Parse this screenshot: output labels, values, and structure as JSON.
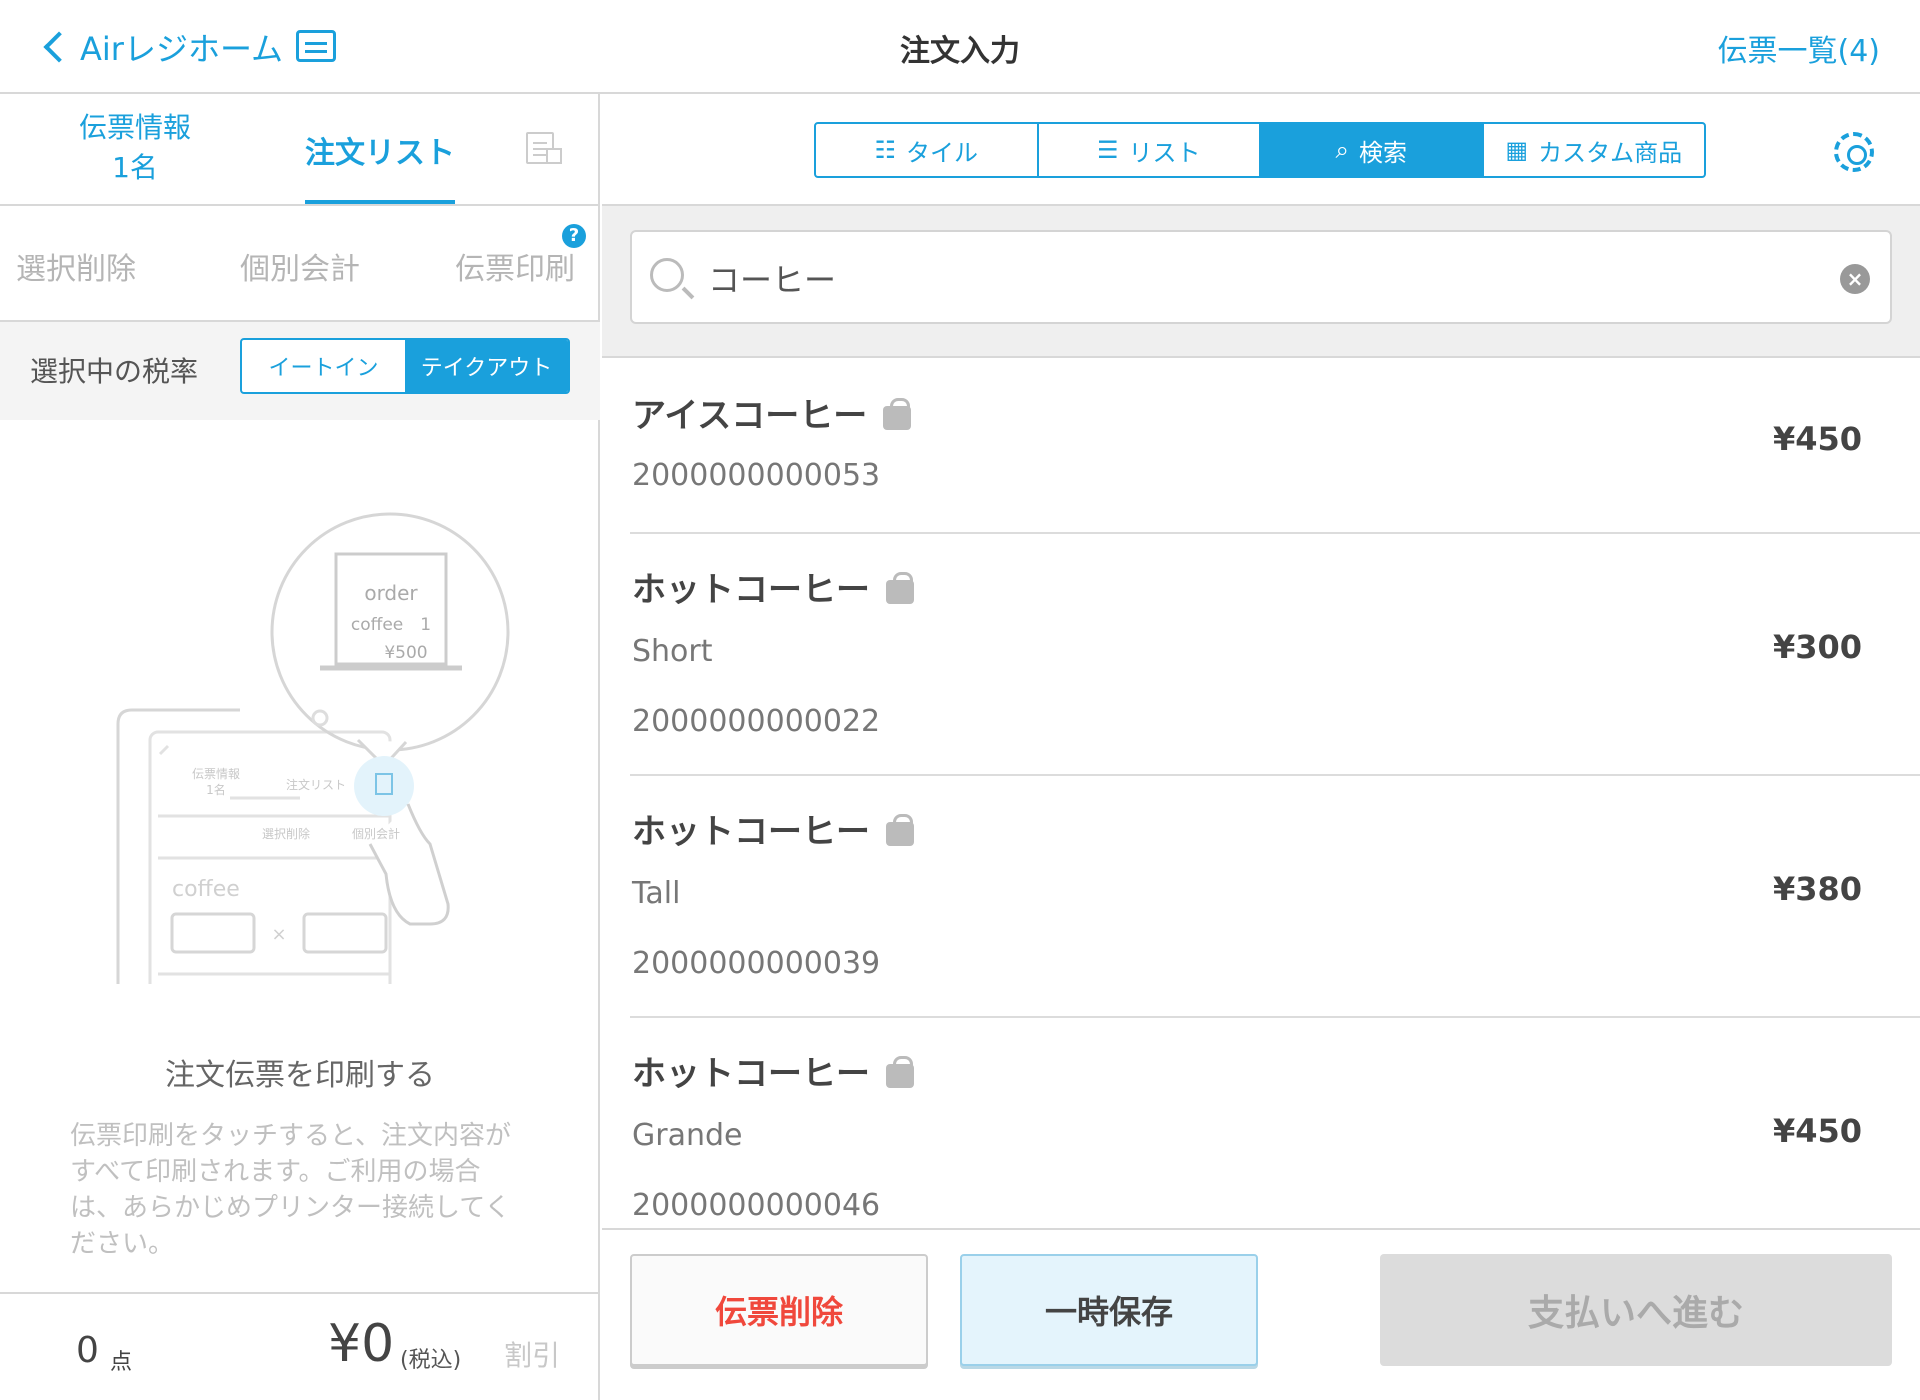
{
  "header": {
    "back_label": "Airレジホーム",
    "title": "注文入力",
    "slip_list_label": "伝票一覧(4)"
  },
  "left": {
    "tabs": {
      "info_line1": "伝票情報",
      "info_line2": "1名",
      "order_list": "注文リスト"
    },
    "actions": {
      "select_delete": "選択削除",
      "separate_checkout": "個別会計",
      "print_slip": "伝票印刷",
      "help": "?"
    },
    "tax": {
      "label": "選択中の税率",
      "eat_in": "イートイン",
      "take_out": "テイクアウト",
      "selected": "テイクアウト"
    },
    "illustration": {
      "receipt_line1": "order",
      "receipt_line2": "coffee　1",
      "receipt_line3": "¥500",
      "mini_tab1_line1": "伝票情報",
      "mini_tab1_line2": "1名",
      "mini_tab2": "注文リスト",
      "mini_action1": "選択削除",
      "mini_action2": "個別会計",
      "mini_item": "coffee",
      "mini_times": "×"
    },
    "print_title": "注文伝票を印刷する",
    "print_desc": "伝票印刷をタッチすると、注文内容がすべて印刷されます。ご利用の場合は、あらかじめプリンター接続してください。",
    "footer": {
      "qty": "0",
      "qty_unit": "点",
      "total": "¥0",
      "tax_incl": "(税込)",
      "discount": "割引"
    }
  },
  "right": {
    "segments": [
      {
        "label": "タイル",
        "icon": "grid-icon"
      },
      {
        "label": "リスト",
        "icon": "list-icon"
      },
      {
        "label": "検索",
        "icon": "search-icon"
      },
      {
        "label": "カスタム商品",
        "icon": "calculator-icon"
      }
    ],
    "active_segment": "検索",
    "search": {
      "value": "コーヒー"
    },
    "results": [
      {
        "name": "アイスコーヒー",
        "sub": "",
        "code": "2000000000053",
        "price": "¥450"
      },
      {
        "name": "ホットコーヒー",
        "sub": "Short",
        "code": "2000000000022",
        "price": "¥300"
      },
      {
        "name": "ホットコーヒー",
        "sub": "Tall",
        "code": "2000000000039",
        "price": "¥380"
      },
      {
        "name": "ホットコーヒー",
        "sub": "Grande",
        "code": "2000000000046",
        "price": "¥450"
      }
    ],
    "footer": {
      "delete_slip": "伝票削除",
      "hold": "一時保存",
      "to_payment": "支払いへ進む"
    }
  },
  "colors": {
    "accent": "#1aa0dc",
    "danger": "#f0483c",
    "disabled": "#dcdcdc"
  }
}
